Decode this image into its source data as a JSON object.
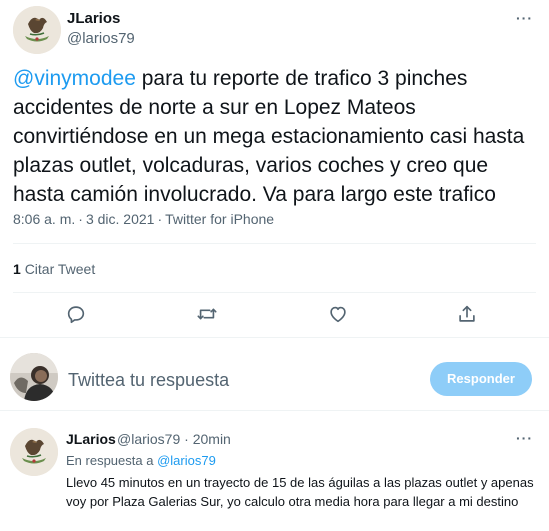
{
  "tweet": {
    "author_name": "JLarios",
    "author_handle": "@larios79",
    "more_icon": "more-icon",
    "mention": "@vinymodee",
    "text": " para tu reporte de trafico 3 pinches accidentes de norte a sur en Lopez Mateos convirtiéndose en un mega estacionamiento casi hasta plazas outlet, volcaduras, varios coches y creo que hasta camión involucrado. Va para largo este trafico",
    "time": "8:06 a. m.",
    "separator": "·",
    "date": "3 dic. 2021",
    "source": "Twitter for iPhone",
    "quote_count": "1",
    "quote_label": "Citar Tweet",
    "actions": {
      "reply_icon": "reply-icon",
      "retweet_icon": "retweet-icon",
      "like_icon": "like-icon",
      "share_icon": "share-icon"
    }
  },
  "compose": {
    "placeholder": "Twittea tu respuesta",
    "button_label": "Responder"
  },
  "reply": {
    "author_name": "JLarios",
    "author_handle": "@larios79",
    "separator": "·",
    "time": "20min",
    "replying_label": "En respuesta a",
    "replying_to": "@larios79",
    "text": "Llevo 45 minutos en un trayecto de 15 de las águilas a las plazas outlet y apenas voy por Plaza Galerias Sur, yo calculo otra media hora para llegar a mi destino"
  },
  "colors": {
    "accent": "#1d9bf0",
    "button_disabled": "#8ecdf8",
    "secondary_text": "#536471",
    "divider": "#eff3f4"
  }
}
